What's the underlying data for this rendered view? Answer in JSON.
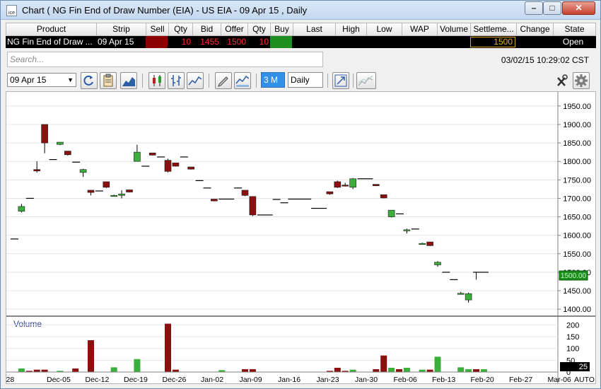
{
  "window": {
    "title": "Chart ( NG Fin End of Draw Number (EIA) - US EIA - 09 Apr 15 , Daily",
    "app_icon_text": "ice",
    "minimize_glyph": "–",
    "maximize_glyph": "□",
    "close_glyph": "✕"
  },
  "grid": {
    "columns": [
      "Product",
      "Strip",
      "Sell",
      "Qty",
      "Bid",
      "Offer",
      "Qty",
      "Buy",
      "Last",
      "High",
      "Low",
      "WAP",
      "Volume",
      "Settleme...",
      "Change",
      "State"
    ],
    "row": {
      "product": "NG Fin End of Draw ...",
      "strip": "09 Apr 15",
      "bid_qty": "10",
      "bid": "1455",
      "offer": "1500",
      "offer_qty": "10",
      "settlement": "1500",
      "state": "Open"
    },
    "colors": {
      "sell_cell": "#8b0000",
      "buy_cell": "#1e8f1e",
      "red_text": "#ff2a2a",
      "settle_border": "#d4a017",
      "settle_text": "#e0b020"
    }
  },
  "search": {
    "placeholder": "Search..."
  },
  "timestamp": "03/02/15 10:29:02 CST",
  "toolbar": {
    "strip_value": "09 Apr 15",
    "range_label": "3 M",
    "period_label": "Daily",
    "icons": [
      "refresh-icon",
      "clipboard-icon",
      "area-chart-icon",
      "candlestick-icon",
      "ohlc-bar-icon",
      "line-chart-icon",
      "pencil-icon",
      "study-icon",
      "expand-icon",
      "trendlines-icon",
      "tools-icon",
      "settings-gear-icon"
    ]
  },
  "chart_data": {
    "type": "candlestick",
    "price_axis": {
      "min": 1385,
      "max": 1965,
      "ticks": [
        1950,
        1900,
        1850,
        1800,
        1750,
        1700,
        1650,
        1600,
        1550,
        1500,
        1450,
        1400
      ]
    },
    "tick_labels": [
      "1950.00",
      "1900.00",
      "1850.00",
      "1800.00",
      "1750.00",
      "1700.00",
      "1650.00",
      "1600.00",
      "1550.00",
      "1500.00",
      "1450.00",
      "1400.00"
    ],
    "last_price_label": "1500.00",
    "x_labels": [
      "-28",
      "Dec-05",
      "Dec-12",
      "Dec-19",
      "Dec-26",
      "Jan-02",
      "Jan-09",
      "Jan-16",
      "Jan-23",
      "Jan-30",
      "Feb-06",
      "Feb-13",
      "Feb-20",
      "Feb-27",
      "Mar-06",
      "AUTO"
    ],
    "colors": {
      "up": "#3cae3c",
      "down": "#8b1010",
      "line": "#000000",
      "grid": "#e4e4e4"
    },
    "candles": [
      {
        "o": 1590,
        "h": 1590,
        "l": 1590,
        "c": 1590
      },
      {
        "o": 1665,
        "h": 1685,
        "l": 1662,
        "c": 1678
      },
      {
        "o": 1700,
        "h": 1700,
        "l": 1700,
        "c": 1700
      },
      {
        "o": 1778,
        "h": 1800,
        "l": 1770,
        "c": 1774
      },
      {
        "o": 1900,
        "h": 1900,
        "l": 1822,
        "c": 1850
      },
      {
        "o": 1805,
        "h": 1805,
        "l": 1805,
        "c": 1805
      },
      {
        "o": 1846,
        "h": 1852,
        "l": 1844,
        "c": 1852
      },
      {
        "o": 1828,
        "h": 1828,
        "l": 1816,
        "c": 1818
      },
      {
        "o": 1798,
        "h": 1798,
        "l": 1798,
        "c": 1798
      },
      {
        "o": 1770,
        "h": 1780,
        "l": 1758,
        "c": 1778
      },
      {
        "o": 1722,
        "h": 1722,
        "l": 1708,
        "c": 1716
      },
      {
        "o": 1720,
        "h": 1720,
        "l": 1720,
        "c": 1720
      },
      {
        "o": 1745,
        "h": 1745,
        "l": 1728,
        "c": 1730
      },
      {
        "o": 1705,
        "h": 1710,
        "l": 1705,
        "c": 1708
      },
      {
        "o": 1708,
        "h": 1722,
        "l": 1700,
        "c": 1712
      },
      {
        "o": 1723,
        "h": 1723,
        "l": 1716,
        "c": 1717
      },
      {
        "o": 1800,
        "h": 1845,
        "l": 1800,
        "c": 1825
      },
      {
        "o": 1787,
        "h": 1787,
        "l": 1787,
        "c": 1787
      },
      {
        "o": 1823,
        "h": 1823,
        "l": 1816,
        "c": 1817
      },
      {
        "o": 1812,
        "h": 1812,
        "l": 1812,
        "c": 1812
      },
      {
        "o": 1803,
        "h": 1807,
        "l": 1770,
        "c": 1773
      },
      {
        "o": 1796,
        "h": 1796,
        "l": 1786,
        "c": 1787
      },
      {
        "o": 1812,
        "h": 1812,
        "l": 1812,
        "c": 1812
      },
      {
        "o": 1785,
        "h": 1785,
        "l": 1778,
        "c": 1779
      },
      {
        "o": 1748,
        "h": 1748,
        "l": 1748,
        "c": 1748
      },
      {
        "o": 1728,
        "h": 1728,
        "l": 1728,
        "c": 1728
      },
      {
        "o": 1698,
        "h": 1698,
        "l": 1692,
        "c": 1693
      },
      {
        "o": 1698,
        "h": 1698,
        "l": 1698,
        "c": 1698
      },
      {
        "o": 1698,
        "h": 1698,
        "l": 1698,
        "c": 1698
      },
      {
        "o": 1728,
        "h": 1728,
        "l": 1728,
        "c": 1728
      },
      {
        "o": 1722,
        "h": 1722,
        "l": 1706,
        "c": 1708
      },
      {
        "o": 1705,
        "h": 1705,
        "l": 1652,
        "c": 1655
      },
      {
        "o": 1655,
        "h": 1655,
        "l": 1655,
        "c": 1655
      },
      {
        "o": 1655,
        "h": 1655,
        "l": 1655,
        "c": 1655
      },
      {
        "o": 1697,
        "h": 1697,
        "l": 1697,
        "c": 1697
      },
      {
        "o": 1688,
        "h": 1688,
        "l": 1688,
        "c": 1688
      },
      {
        "o": 1698,
        "h": 1698,
        "l": 1698,
        "c": 1698
      },
      {
        "o": 1698,
        "h": 1698,
        "l": 1698,
        "c": 1698
      },
      {
        "o": 1698,
        "h": 1698,
        "l": 1698,
        "c": 1698
      },
      {
        "o": 1673,
        "h": 1673,
        "l": 1673,
        "c": 1673
      },
      {
        "o": 1673,
        "h": 1673,
        "l": 1673,
        "c": 1673
      },
      {
        "o": 1718,
        "h": 1718,
        "l": 1710,
        "c": 1712
      },
      {
        "o": 1745,
        "h": 1748,
        "l": 1728,
        "c": 1730
      },
      {
        "o": 1736,
        "h": 1742,
        "l": 1732,
        "c": 1733
      },
      {
        "o": 1730,
        "h": 1755,
        "l": 1725,
        "c": 1753
      },
      {
        "o": 1753,
        "h": 1753,
        "l": 1753,
        "c": 1753
      },
      {
        "o": 1753,
        "h": 1753,
        "l": 1753,
        "c": 1753
      },
      {
        "o": 1738,
        "h": 1738,
        "l": 1733,
        "c": 1734
      },
      {
        "o": 1710,
        "h": 1710,
        "l": 1700,
        "c": 1701
      },
      {
        "o": 1650,
        "h": 1668,
        "l": 1648,
        "c": 1668
      },
      {
        "o": 1658,
        "h": 1658,
        "l": 1658,
        "c": 1658
      },
      {
        "o": 1612,
        "h": 1618,
        "l": 1605,
        "c": 1615
      },
      {
        "o": 1617,
        "h": 1617,
        "l": 1617,
        "c": 1617
      },
      {
        "o": 1575,
        "h": 1580,
        "l": 1575,
        "c": 1578
      },
      {
        "o": 1582,
        "h": 1582,
        "l": 1571,
        "c": 1572
      },
      {
        "o": 1520,
        "h": 1530,
        "l": 1515,
        "c": 1527
      },
      {
        "o": 1500,
        "h": 1500,
        "l": 1500,
        "c": 1500
      },
      {
        "o": 1480,
        "h": 1480,
        "l": 1480,
        "c": 1480
      },
      {
        "o": 1440,
        "h": 1447,
        "l": 1440,
        "c": 1443
      },
      {
        "o": 1425,
        "h": 1445,
        "l": 1418,
        "c": 1442
      },
      {
        "o": 1500,
        "h": 1500,
        "l": 1480,
        "c": 1500
      },
      {
        "o": 1500,
        "h": 1500,
        "l": 1500,
        "c": 1500
      }
    ],
    "volume": {
      "label": "Volume",
      "max": 200,
      "ticks": [
        200,
        150,
        100,
        50,
        0
      ],
      "tick_labels": [
        "200",
        "150",
        "100",
        "50",
        "0"
      ],
      "current_label": "25",
      "values": [
        0,
        15,
        5,
        10,
        10,
        0,
        5,
        0,
        15,
        0,
        135,
        0,
        0,
        20,
        0,
        0,
        55,
        0,
        0,
        0,
        205,
        10,
        0,
        0,
        0,
        0,
        0,
        8,
        0,
        0,
        12,
        12,
        0,
        0,
        0,
        0,
        0,
        0,
        0,
        0,
        0,
        5,
        18,
        5,
        10,
        0,
        0,
        12,
        70,
        18,
        12,
        18,
        0,
        10,
        10,
        65,
        0,
        0,
        20,
        12,
        12,
        12
      ]
    }
  }
}
